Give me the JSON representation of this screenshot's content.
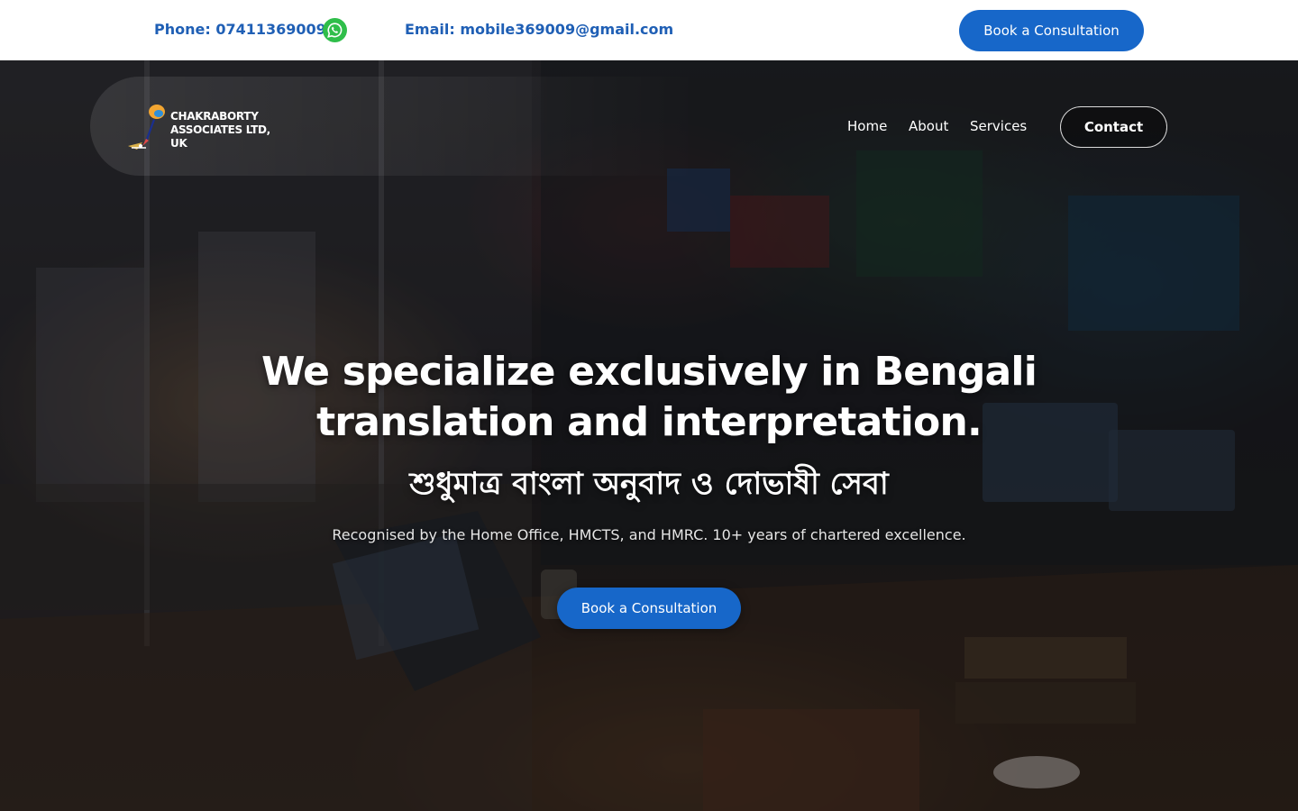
{
  "topbar": {
    "phone": "Phone: 07411369009",
    "email": "Email: mobile369009@gmail.com",
    "book_label": "Book a Consultation"
  },
  "brand": {
    "name": "CHAKRABORTY ASSOCIATES LTD, UK"
  },
  "nav": {
    "items": [
      {
        "label": "Home"
      },
      {
        "label": "About"
      },
      {
        "label": "Services"
      }
    ],
    "contact_label": "Contact"
  },
  "hero": {
    "headline": "We specialize exclusively in Bengali translation and interpretation.",
    "bengali_tagline": "শুধুমাত্র বাংলা অনুবাদ ও দোভাষী সেবা",
    "subline": "Recognised by the Home Office, HMCTS, and HMRC. 10+ years of chartered excellence.",
    "cta_label": "Book a Consultation"
  },
  "colors": {
    "brand_blue": "#1767c9",
    "link_blue": "#1f5fb5",
    "whatsapp_green": "#2fbe4a"
  },
  "icons": [
    "whatsapp-icon",
    "logo-mark"
  ]
}
